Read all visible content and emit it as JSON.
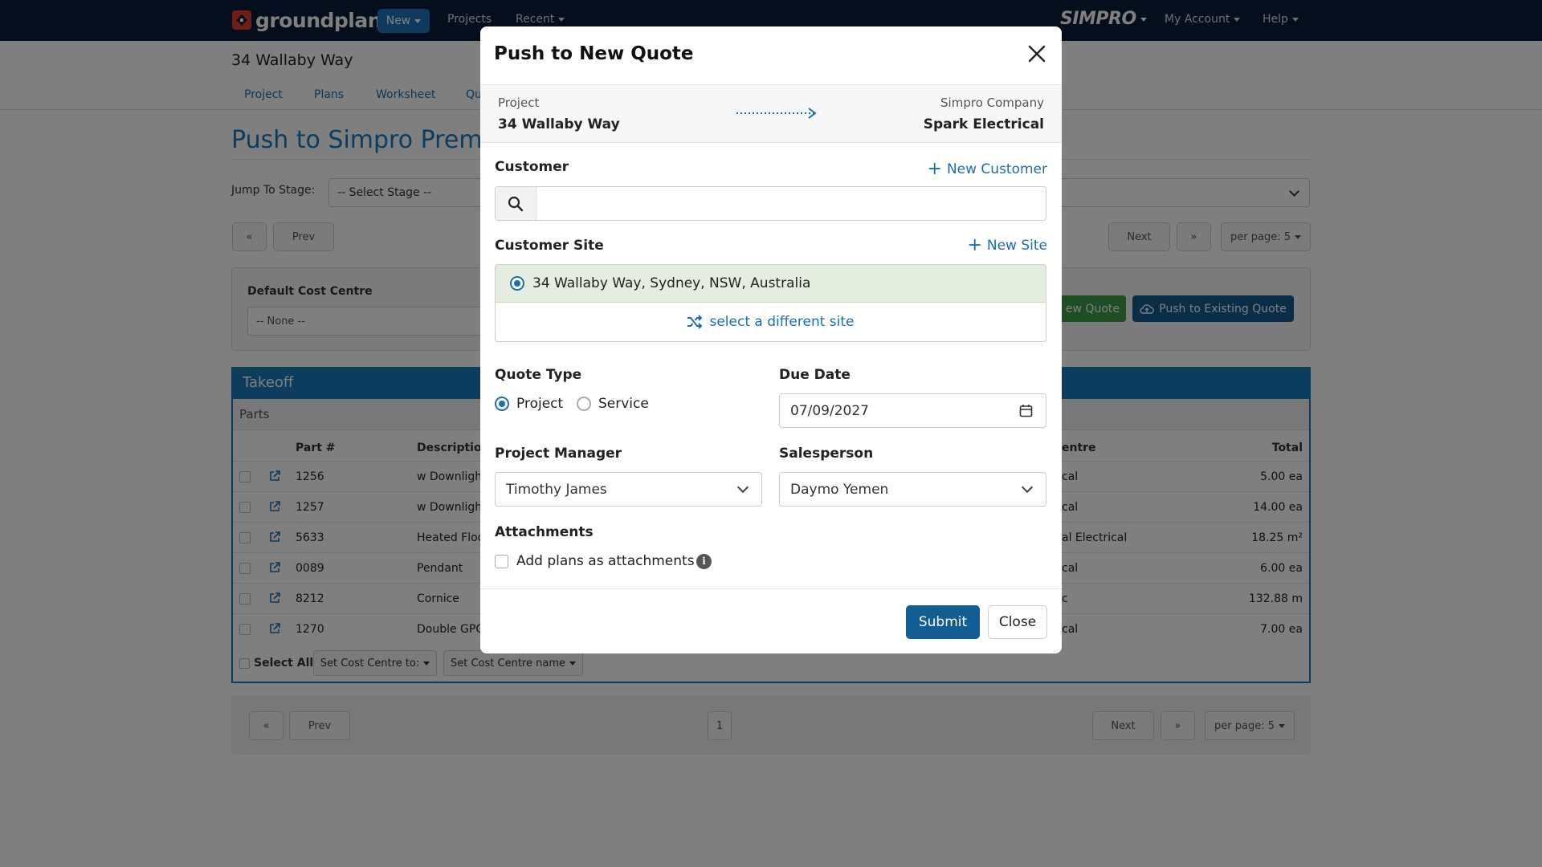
{
  "nav": {
    "brand": "groundplan",
    "new_label": "New",
    "projects_label": "Projects",
    "recent_label": "Recent",
    "simpro_label": "SIMPRO",
    "account_label": "My Account",
    "help_label": "Help"
  },
  "page": {
    "title": "34 Wallaby Way",
    "tabs": [
      "Project",
      "Plans",
      "Worksheet",
      "Qu"
    ],
    "push_title": "Push to Simpro Premiu",
    "jump_label": "Jump To Stage:",
    "stage_placeholder": "-- Select Stage --",
    "prev_label": "Prev",
    "next_label": "Next",
    "per_page_label": "per page: 5",
    "default_cost_centre_label": "Default Cost Centre",
    "cost_centre_value": "-- None --",
    "push_new_partial": "ew Quote",
    "push_existing_label": "Push to Existing Quote",
    "takeoff_title": "Takeoff",
    "parts_label": "Parts",
    "columns": {
      "part": "Part #",
      "description": "Description",
      "cost_centre": "entre",
      "total": "Total"
    },
    "rows": [
      {
        "part": "1256",
        "desc": "w Downligh",
        "cc": "cal",
        "total": "5.00 ea"
      },
      {
        "part": "1257",
        "desc": "w Downligh",
        "cc": "cal",
        "total": "14.00 ea"
      },
      {
        "part": "5633",
        "desc": "Heated Floo",
        "cc": "al Electrical",
        "total": "18.25 m²"
      },
      {
        "part": "0089",
        "desc": "Pendant",
        "cc": "cal",
        "total": "6.00 ea"
      },
      {
        "part": "8212",
        "desc": "Cornice",
        "cc": "c",
        "total": "132.88 m"
      },
      {
        "part": "1270",
        "desc": "Double GPO",
        "cc": "cal",
        "total": "7.00 ea"
      }
    ],
    "select_all_label": "Select All",
    "set_cc_label": "Set Cost Centre to:",
    "set_cc_name_label": "Set Cost Centre name",
    "page_number": "1"
  },
  "modal": {
    "title": "Push to New Quote",
    "project_label": "Project",
    "project_value": "34 Wallaby Way",
    "company_label": "Simpro Company",
    "company_value": "Spark Electrical",
    "customer_label": "Customer",
    "new_customer_label": "New Customer",
    "customer_search_value": "",
    "site_label": "Customer Site",
    "new_site_label": "New Site",
    "selected_site": "34 Wallaby Way, Sydney, NSW, Australia",
    "different_site_label": "select a different site",
    "quote_type_label": "Quote Type",
    "quote_type_options": [
      "Project",
      "Service"
    ],
    "quote_type_selected": "Project",
    "due_date_label": "Due Date",
    "due_date_value": "07/09/2027",
    "pm_label": "Project Manager",
    "pm_value": "Timothy James",
    "salesperson_label": "Salesperson",
    "salesperson_value": "Daymo Yemen",
    "attachments_label": "Attachments",
    "attach_plans_label": "Add plans as attachments",
    "attach_plans_checked": false,
    "submit_label": "Submit",
    "close_label": "Close"
  },
  "colors": {
    "nav_bg": "#0b1d3a",
    "accent": "#1b6fb0",
    "primary_button": "#125d93",
    "site_selected_bg": "#e4ede0",
    "green_button": "#3c9d46"
  }
}
